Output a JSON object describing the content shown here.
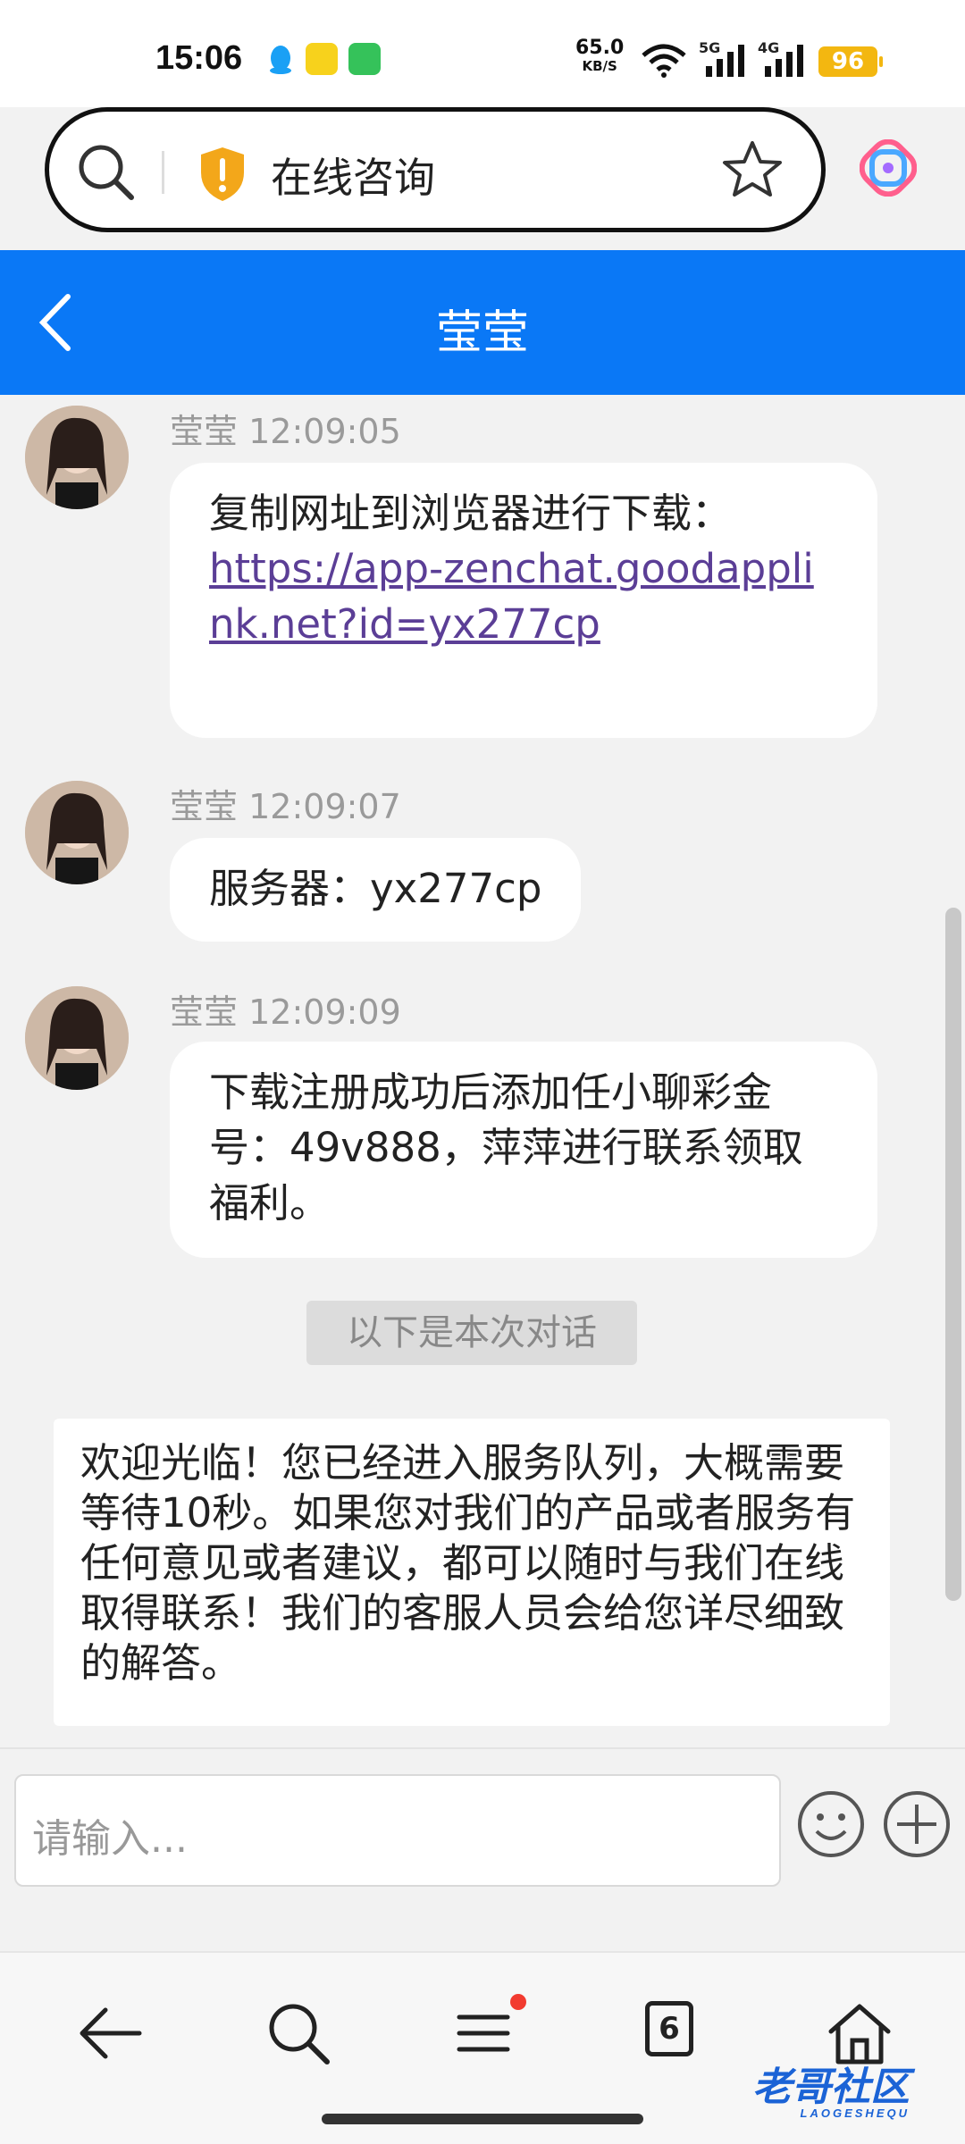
{
  "status_bar": {
    "time": "15:06",
    "net_speed_value": "65.0",
    "net_speed_unit": "KB/S",
    "signal_1": "5G",
    "signal_2": "4G",
    "battery": "96"
  },
  "address_bar": {
    "page_title": "在线咨询",
    "icons": [
      "search-icon",
      "security-warning-icon",
      "star-icon"
    ]
  },
  "chat": {
    "title": "莹莹",
    "messages": [
      {
        "sender": "莹莹",
        "time": "12:09:05",
        "text": "复制网址到浏览器进行下载：",
        "link": "https://app-zenchat.goodapplink.net?id=yx277cp"
      },
      {
        "sender": "莹莹",
        "time": "12:09:07",
        "text": "服务器：yx277cp"
      },
      {
        "sender": "莹莹",
        "time": "12:09:09",
        "text": "下载注册成功后添加任小聊彩金号：49v888，萍萍进行联系领取福利。"
      }
    ],
    "divider": "以下是本次对话",
    "welcome": "欢迎光临！您已经进入服务队列，大概需要等待10秒。如果您对我们的产品或者服务有任何意见或者建议，都可以随时与我们在线取得联系！我们的客服人员会给您详尽细致的解答。"
  },
  "composer": {
    "placeholder": "请输入..."
  },
  "bottom_nav": {
    "tab_count": "6",
    "items": [
      "back-icon",
      "search-icon",
      "menu-icon",
      "tabs-icon",
      "home-icon"
    ]
  },
  "watermark": {
    "text": "老哥社区",
    "subtext": "LAOGESHEQU"
  },
  "colors": {
    "header_blue": "#0a78f6",
    "battery_yellow": "#f3b710",
    "link_purple": "#5b3e96"
  }
}
